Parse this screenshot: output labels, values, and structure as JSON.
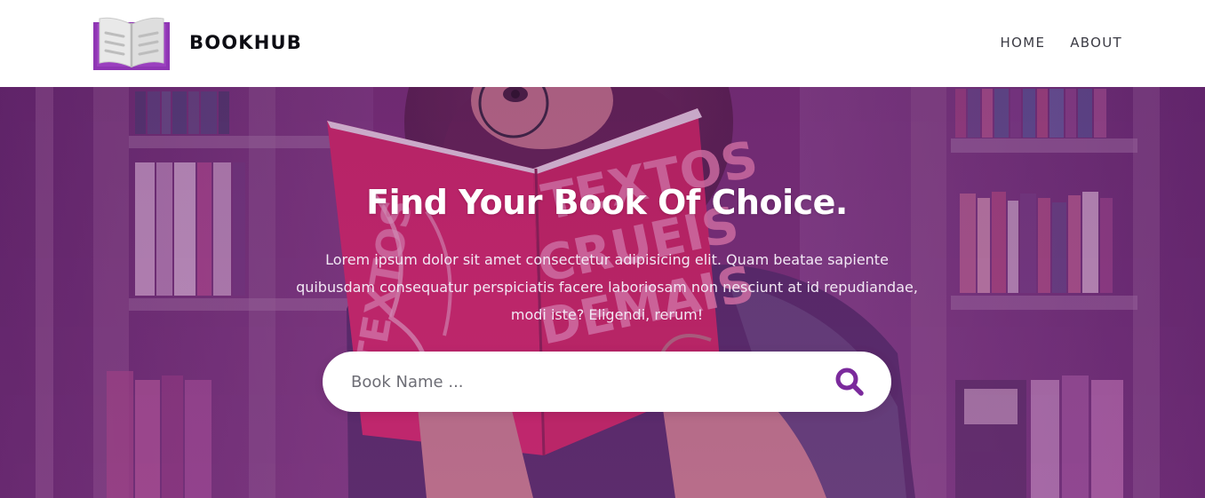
{
  "header": {
    "brand": "BOOKHUB",
    "nav": [
      {
        "label": "HOME"
      },
      {
        "label": "ABOUT"
      }
    ],
    "logo_icon": "open-book-icon"
  },
  "hero": {
    "title": "Find Your Book Of Choice.",
    "description": "Lorem ipsum dolor sit amet consectetur adipisicing elit. Quam beatae sapiente quibusdam consequatur perspiciatis facere laboriosam non nesciunt at id repudiandae, modi iste? Eligendi, rerum!",
    "search": {
      "placeholder": "Book Name ...",
      "value": "",
      "button_icon": "search-icon"
    },
    "background_image": "woman reading a red book in a library"
  },
  "colors": {
    "accent": "#7b2a9c",
    "logo_book": "#e4e4e4",
    "logo_base": "#9a3dba",
    "hero_overlay": "#6e2a7a",
    "header_bg": "#ffffff"
  }
}
